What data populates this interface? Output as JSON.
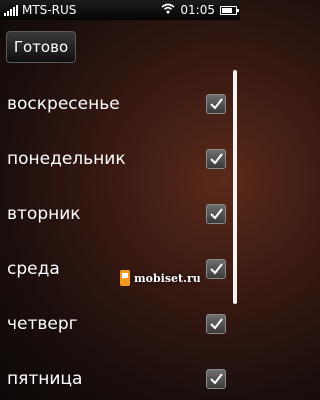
{
  "status_bar": {
    "carrier": "MTS-RUS",
    "time": "01:05",
    "battery_level": 0.8
  },
  "toolbar": {
    "done_label": "Готово"
  },
  "days": [
    {
      "label": "воскресенье",
      "checked": true
    },
    {
      "label": "понедельник",
      "checked": true
    },
    {
      "label": "вторник",
      "checked": true
    },
    {
      "label": "среда",
      "checked": true
    },
    {
      "label": "четверг",
      "checked": true
    },
    {
      "label": "пятница",
      "checked": true
    }
  ],
  "watermark": {
    "text": "mobiset.ru"
  },
  "colors": {
    "accent_orange": "#f29a1d",
    "background": "#3a1a12"
  }
}
